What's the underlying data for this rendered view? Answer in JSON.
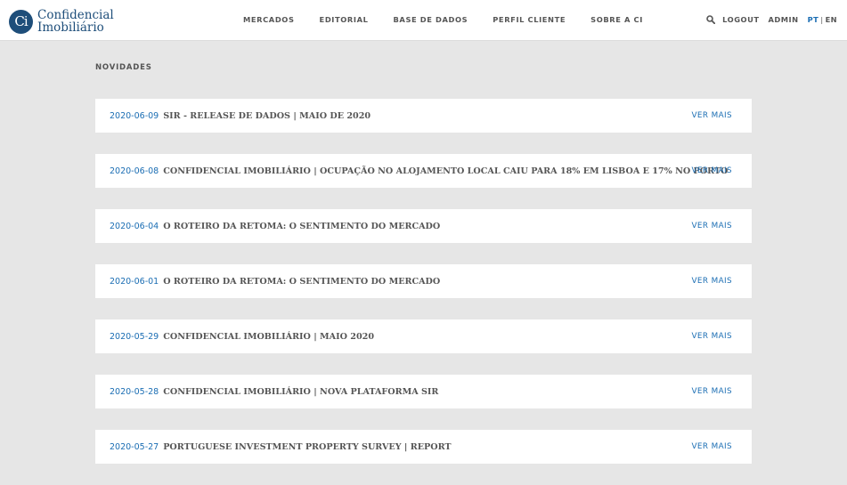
{
  "brand": {
    "logo_mark": "Ci",
    "line1": "Confidencial",
    "line2": "Imobiliário"
  },
  "nav": [
    "MERCADOS",
    "EDITORIAL",
    "BASE DE DADOS",
    "PERFIL CLIENTE",
    "SOBRE A CI"
  ],
  "header_right": {
    "search_icon": "search-icon",
    "logout": "LOGOUT",
    "admin": "ADMIN",
    "lang_pt": "PT",
    "lang_sep": "|",
    "lang_en": "EN"
  },
  "section_title": "NOVIDADES",
  "news": [
    {
      "date": "2020-06-09",
      "title": "SIR - RELEASE DE DADOS | MAIO DE 2020",
      "more": "VER MAIS"
    },
    {
      "date": "2020-06-08",
      "title": "CONFIDENCIAL IMOBILIÁRIO | OCUPAÇÃO NO ALOJAMENTO LOCAL CAIU PARA 18% EM LISBOA E 17% NO PORTO",
      "more": "VER MAIS"
    },
    {
      "date": "2020-06-04",
      "title": "O ROTEIRO DA RETOMA: O SENTIMENTO DO MERCADO",
      "more": "VER MAIS"
    },
    {
      "date": "2020-06-01",
      "title": "O ROTEIRO DA RETOMA: O SENTIMENTO DO MERCADO",
      "more": "VER MAIS"
    },
    {
      "date": "2020-05-29",
      "title": "CONFIDENCIAL IMOBILIÁRIO | MAIO 2020",
      "more": "VER MAIS"
    },
    {
      "date": "2020-05-28",
      "title": "CONFIDENCIAL IMOBILIÁRIO | NOVA PLATAFORMA SIR",
      "more": "VER MAIS"
    },
    {
      "date": "2020-05-27",
      "title": "PORTUGUESE INVESTMENT PROPERTY SURVEY | REPORT",
      "more": "VER MAIS"
    }
  ],
  "colors": {
    "accent": "#1a6db3",
    "brand": "#1e4e7a",
    "background": "#e6e6e6",
    "card": "#ffffff"
  }
}
